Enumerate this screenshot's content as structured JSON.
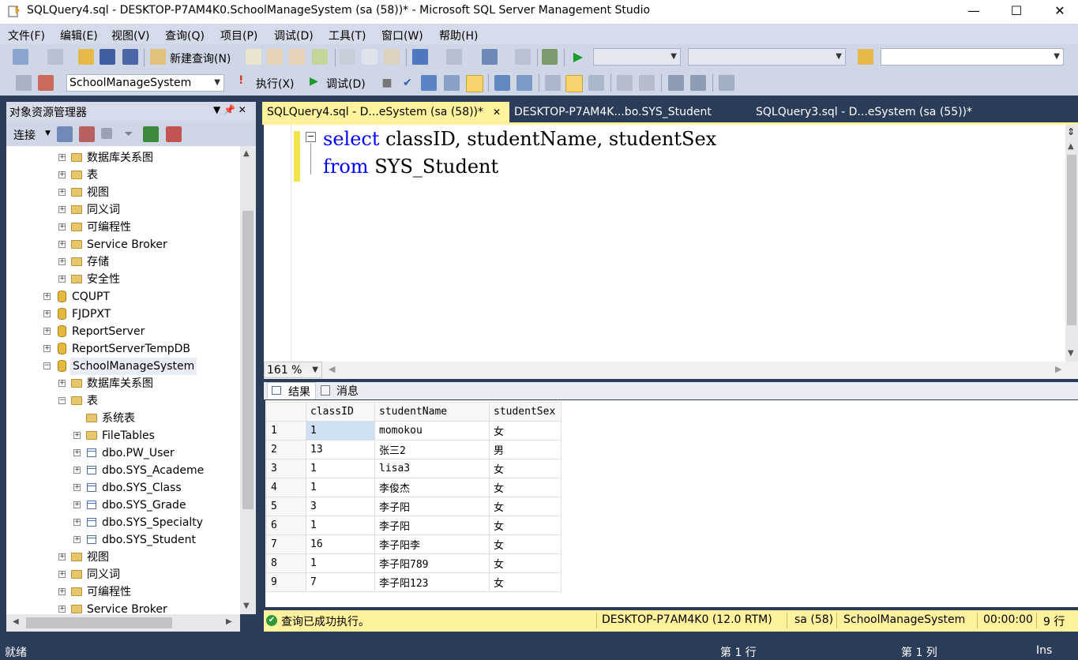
{
  "window": {
    "title": "SQLQuery4.sql - DESKTOP-P7AM4K0.SchoolManageSystem (sa (58))* - Microsoft SQL Server Management Studio",
    "minimize": "—",
    "maximize": "☐",
    "close": "✕"
  },
  "menu": [
    "文件(F)",
    "编辑(E)",
    "视图(V)",
    "查询(Q)",
    "项目(P)",
    "调试(D)",
    "工具(T)",
    "窗口(W)",
    "帮助(H)"
  ],
  "toolbar1": {
    "new_query": "新建查询(N)",
    "combo_a": "",
    "combo_b": "",
    "search_value": ""
  },
  "toolbar2": {
    "database": "SchoolManageSystem",
    "execute": "执行(X)",
    "debug": "调试(D)"
  },
  "object_explorer": {
    "title": "对象资源管理器",
    "pin": "▼ 📌 ✕",
    "connect": "连接",
    "nodes": [
      {
        "label": "数据库关系图",
        "expander": "+"
      },
      {
        "label": "表",
        "expander": "+"
      },
      {
        "label": "视图",
        "expander": "+"
      },
      {
        "label": "同义词",
        "expander": "+"
      },
      {
        "label": "可编程性",
        "expander": "+"
      },
      {
        "label": "Service Broker",
        "expander": "+"
      },
      {
        "label": "存储",
        "expander": "+"
      },
      {
        "label": "安全性",
        "expander": "+"
      },
      {
        "label": "CQUPT",
        "expander": "+"
      },
      {
        "label": "FJDPXT",
        "expander": "+"
      },
      {
        "label": "ReportServer",
        "expander": "+"
      },
      {
        "label": "ReportServerTempDB",
        "expander": "+"
      },
      {
        "label": "SchoolManageSystem",
        "expander": "−"
      },
      {
        "label": "数据库关系图",
        "expander": "+"
      },
      {
        "label": "表",
        "expander": "−"
      },
      {
        "label": "系统表",
        "expander": ""
      },
      {
        "label": "FileTables",
        "expander": "+"
      },
      {
        "label": "dbo.PW_User",
        "expander": "+"
      },
      {
        "label": "dbo.SYS_Academe",
        "expander": "+"
      },
      {
        "label": "dbo.SYS_Class",
        "expander": "+"
      },
      {
        "label": "dbo.SYS_Grade",
        "expander": "+"
      },
      {
        "label": "dbo.SYS_Specialty",
        "expander": "+"
      },
      {
        "label": "dbo.SYS_Student",
        "expander": "+"
      },
      {
        "label": "视图",
        "expander": "+"
      },
      {
        "label": "同义词",
        "expander": "+"
      },
      {
        "label": "可编程性",
        "expander": "+"
      },
      {
        "label": "Service Broker",
        "expander": "+"
      }
    ]
  },
  "tabs": [
    {
      "label": "SQLQuery4.sql - D...eSystem (sa (58))*",
      "close": "✕"
    },
    {
      "label": "DESKTOP-P7AM4K...bo.SYS_Student"
    },
    {
      "label": "SQLQuery3.sql - D...eSystem (sa (55))*"
    }
  ],
  "editor": {
    "line1": {
      "keyword": "select",
      "rest": " classID, studentName, studentSex"
    },
    "line2": {
      "keyword": "from",
      "rest": " SYS_Student"
    },
    "zoom": "161 %"
  },
  "results": {
    "tab_results": "结果",
    "tab_messages": "消息",
    "columns": [
      "classID",
      "studentName",
      "studentSex"
    ],
    "rows": [
      [
        "1",
        "1",
        "momokou",
        "女"
      ],
      [
        "2",
        "13",
        "张三2",
        "男"
      ],
      [
        "3",
        "1",
        "lisa3",
        "女"
      ],
      [
        "4",
        "1",
        "李俊杰",
        "女"
      ],
      [
        "5",
        "3",
        "李子阳",
        "女"
      ],
      [
        "6",
        "1",
        "李子阳",
        "女"
      ],
      [
        "7",
        "16",
        "李子阳李",
        "女"
      ],
      [
        "8",
        "1",
        "李子阳789",
        "女"
      ],
      [
        "9",
        "7",
        "李子阳123",
        "女"
      ]
    ]
  },
  "query_status": {
    "message": "查询已成功执行。",
    "server": "DESKTOP-P7AM4K0 (12.0 RTM)",
    "user": "sa (58)",
    "database": "SchoolManageSystem",
    "time": "00:00:00",
    "rows": "9 行"
  },
  "statusbar": {
    "ready": "就绪",
    "line": "第 1 行",
    "col": "第 1 列",
    "mode": "Ins"
  },
  "colors": {
    "chrome": "#2b3c59",
    "toolbar": "#cfd6e5",
    "active_tab": "#fff29d",
    "keyword": "#0000ff"
  }
}
